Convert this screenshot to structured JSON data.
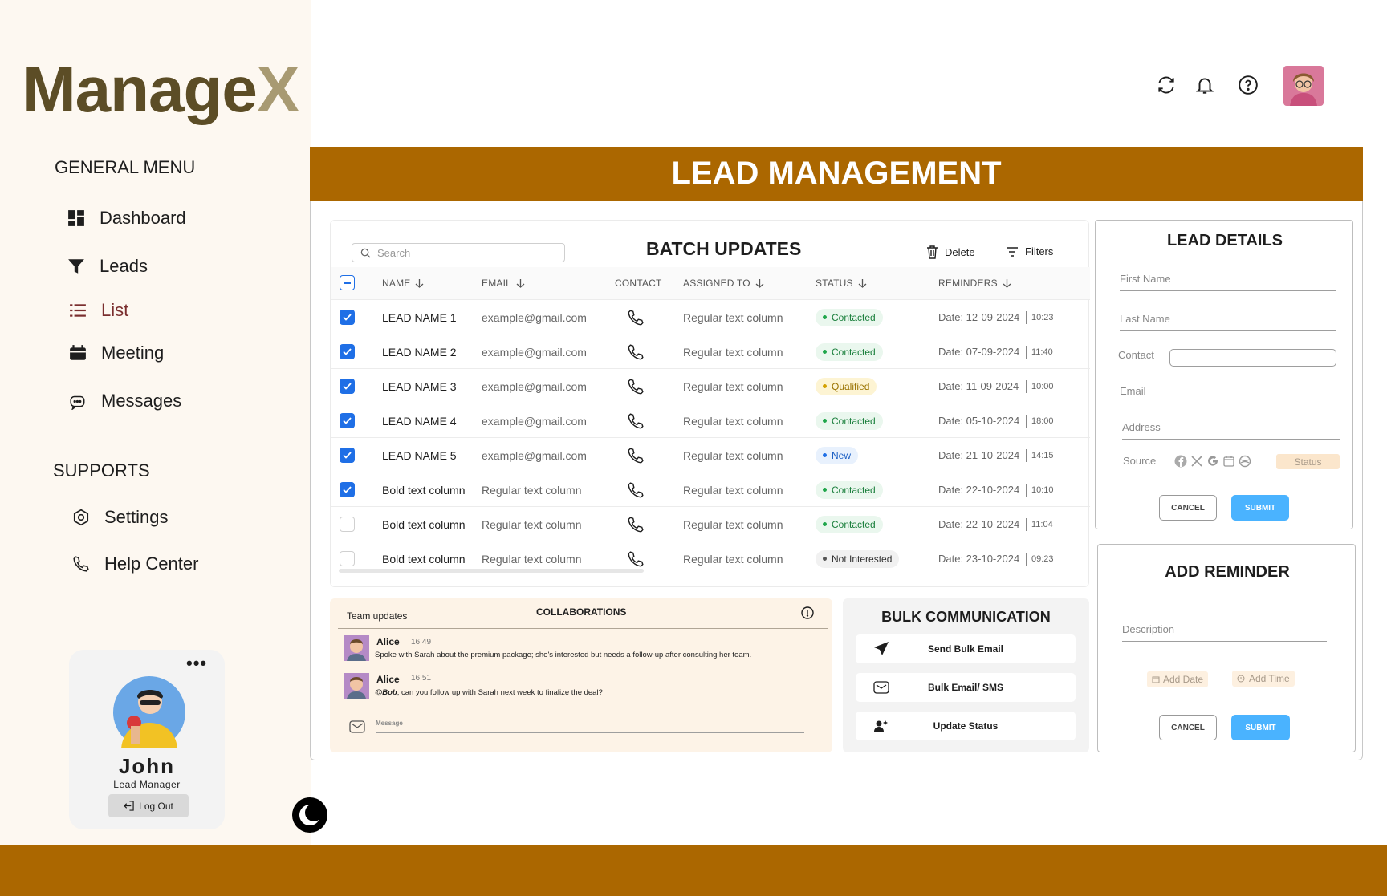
{
  "app": {
    "logo_main": "Manage",
    "logo_x": "X"
  },
  "sidebar": {
    "general_heading": "GENERAL MENU",
    "general_items": [
      {
        "label": "Dashboard",
        "icon": "dashboard-icon"
      },
      {
        "label": "Leads",
        "icon": "funnel-icon"
      },
      {
        "label": "List",
        "icon": "list-icon",
        "active": true
      },
      {
        "label": "Meeting",
        "icon": "calendar-icon"
      },
      {
        "label": "Messages",
        "icon": "chat-icon"
      }
    ],
    "supports_heading": "SUPPORTS",
    "support_items": [
      {
        "label": "Settings",
        "icon": "settings-icon"
      },
      {
        "label": "Help Center",
        "icon": "phone-icon"
      }
    ],
    "profile": {
      "name": "John",
      "role": "Lead Manager",
      "logout": "Log Out",
      "menu": "•••"
    }
  },
  "header": {
    "icons": [
      "refresh-icon",
      "bell-icon",
      "help-icon",
      "avatar"
    ]
  },
  "banner": {
    "title": "LEAD MANAGEMENT"
  },
  "batch": {
    "title": "BATCH UPDATES",
    "search_placeholder": "Search",
    "delete_label": "Delete",
    "filters_label": "Filters",
    "columns": [
      "NAME",
      "EMAIL",
      "CONTACT",
      "ASSIGNED TO",
      "STATUS",
      "REMINDERS"
    ],
    "rows": [
      {
        "checked": true,
        "name": "LEAD NAME 1",
        "email": "example@gmail.com",
        "assigned": "Regular text column",
        "status": "Contacted",
        "date": "Date: 12-09-2024",
        "time": "10:23"
      },
      {
        "checked": true,
        "name": "LEAD NAME 2",
        "email": "example@gmail.com",
        "assigned": "Regular text column",
        "status": "Contacted",
        "date": "Date: 07-09-2024",
        "time": "11:40"
      },
      {
        "checked": true,
        "name": "LEAD NAME 3",
        "email": "example@gmail.com",
        "assigned": "Regular text column",
        "status": "Qualified",
        "date": "Date: 11-09-2024",
        "time": "10:00"
      },
      {
        "checked": true,
        "name": "LEAD NAME 4",
        "email": "example@gmail.com",
        "assigned": "Regular text column",
        "status": "Contacted",
        "date": "Date: 05-10-2024",
        "time": "18:00"
      },
      {
        "checked": true,
        "name": "LEAD NAME 5",
        "email": "example@gmail.com",
        "assigned": "Regular text column",
        "status": "New",
        "date": "Date: 21-10-2024",
        "time": "14:15"
      },
      {
        "checked": true,
        "name": "Bold text column",
        "email": "Regular text column",
        "assigned": "Regular text column",
        "status": "Contacted",
        "date": "Date: 22-10-2024",
        "time": "10:10"
      },
      {
        "checked": false,
        "name": "Bold text column",
        "email": "Regular text column",
        "assigned": "Regular text column",
        "status": "Contacted",
        "date": "Date: 22-10-2024",
        "time": "11:04"
      },
      {
        "checked": false,
        "name": "Bold text column",
        "email": "Regular text column",
        "assigned": "Regular text column",
        "status": "Not Interested",
        "date": "Date: 23-10-2024",
        "time": "09:23"
      }
    ],
    "status_colors": {
      "Contacted": {
        "bg": "#eaf7ee",
        "fg": "#1a7f3c",
        "dot": "#1fa64a"
      },
      "Qualified": {
        "bg": "#fdf4d3",
        "fg": "#9a7300",
        "dot": "#d4a000"
      },
      "New": {
        "bg": "#e8f1fd",
        "fg": "#1b5fc4",
        "dot": "#1f6fe6"
      },
      "Not Interested": {
        "bg": "#f1f1f1",
        "fg": "#333333",
        "dot": "#555555"
      }
    }
  },
  "lead_details": {
    "title": "LEAD DETAILS",
    "first_name": "First Name",
    "last_name": "Last Name",
    "contact": "Contact",
    "email": "Email",
    "address": "Address",
    "source": "Source",
    "status": "Status",
    "cancel": "CANCEL",
    "submit": "SUBMIT"
  },
  "reminder": {
    "title": "ADD REMINDER",
    "description": "Description",
    "add_date": "Add Date",
    "add_time": "Add Time",
    "cancel": "CANCEL",
    "submit": "SUBMIT"
  },
  "collab": {
    "team_updates": "Team updates",
    "title": "COLLABORATIONS",
    "messages": [
      {
        "author": "Alice",
        "time": "16:49",
        "mention": "",
        "text": "Spoke with Sarah about the premium package; she's interested but needs a follow-up after consulting her team."
      },
      {
        "author": "Alice",
        "time": "16:51",
        "mention": "@Bob",
        "text": ", can you follow up with Sarah next week to finalize the deal?"
      }
    ],
    "message_placeholder": "Message"
  },
  "bulk": {
    "title": "BULK COMMUNICATION",
    "buttons": [
      "Send Bulk Email",
      "Bulk Email/ SMS",
      "Update Status"
    ]
  },
  "colors": {
    "brand": "#ab6700",
    "accent": "#4ab3ff",
    "check": "#1f6fe6"
  }
}
